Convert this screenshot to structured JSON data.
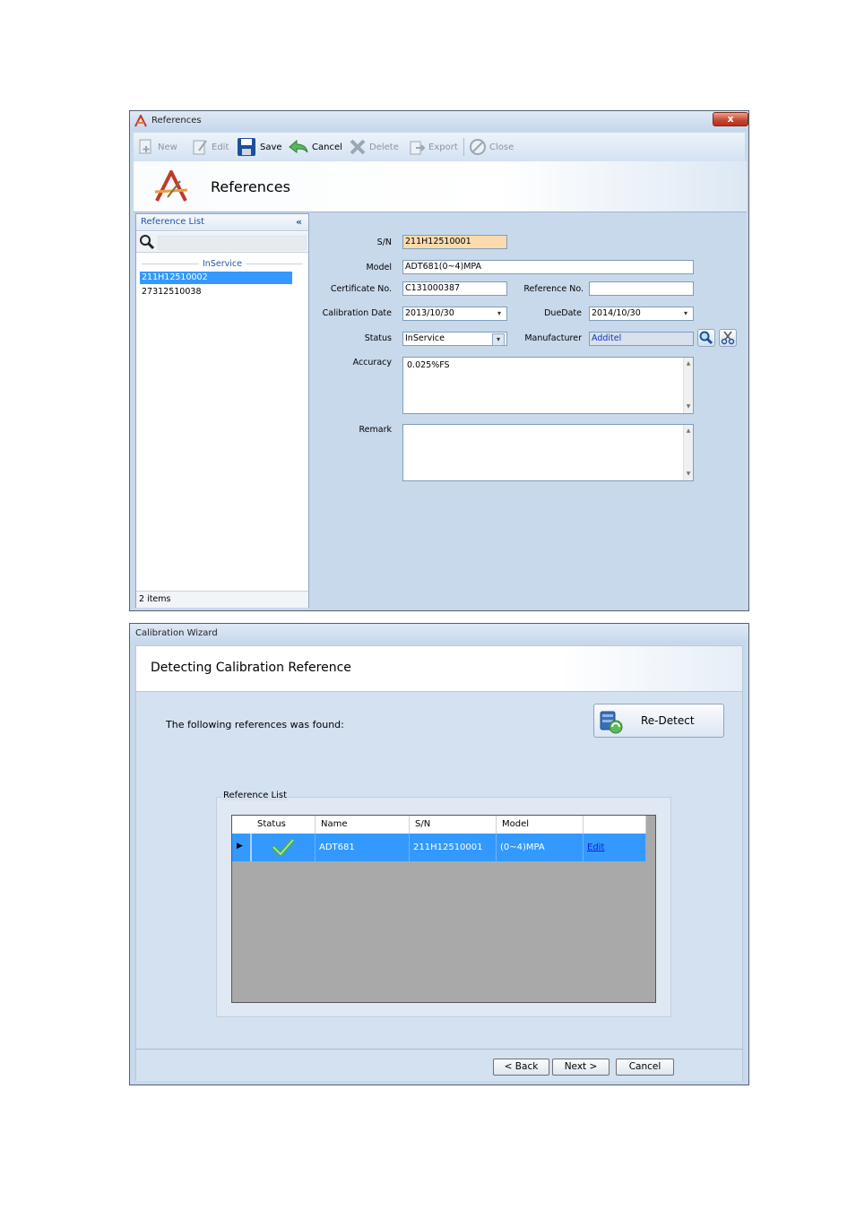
{
  "references_window": {
    "title": "References",
    "close_symbol": "x",
    "toolbar": {
      "new_label": "New",
      "edit_label": "Edit",
      "save_label": "Save",
      "cancel_label": "Cancel",
      "delete_label": "Delete",
      "export_label": "Export",
      "close_label": "Close"
    },
    "header_title": "References",
    "reference_list": {
      "title": "Reference List",
      "collapse_symbol": "«",
      "group": "InService",
      "items": [
        "211H12510002",
        "27312510038"
      ],
      "selected_index": 0,
      "footer": "2 items"
    },
    "form": {
      "sn_label": "S/N",
      "sn_value": "211H12510001",
      "model_label": "Model",
      "model_value": "ADT681(0~4)MPA",
      "certificate_label": "Certificate No.",
      "certificate_value": "C131000387",
      "reference_no_label": "Reference No.",
      "reference_no_value": "",
      "calibration_date_label": "Calibration Date",
      "calibration_date_value": "2013/10/30",
      "due_date_label": "DueDate",
      "due_date_value": "2014/10/30",
      "status_label": "Status",
      "status_value": "InService",
      "manufacturer_label": "Manufacturer",
      "manufacturer_value": "Additel",
      "accuracy_label": "Accuracy",
      "accuracy_value": "0.025%FS",
      "remark_label": "Remark",
      "remark_value": ""
    }
  },
  "wizard_window": {
    "title": "Calibration Wizard",
    "heading": "Detecting Calibration Reference",
    "found_text": "The following references was found:",
    "redetect_label": "Re-Detect",
    "group_label": "Reference List",
    "columns": [
      "Status",
      "Name",
      "S/N",
      "Model",
      ""
    ],
    "rows": [
      {
        "status": "ok",
        "name": "ADT681",
        "sn": "211H12510001",
        "model": "(0~4)MPA",
        "action": "Edit"
      }
    ],
    "back_label": "< Back",
    "next_label": "Next >",
    "cancel_label": "Cancel"
  },
  "colors": {
    "selection": "#3399ff",
    "window_bg": "#c9d9ec",
    "sn_highlight": "#fbdbae"
  }
}
